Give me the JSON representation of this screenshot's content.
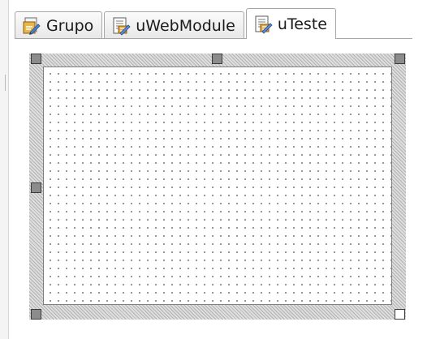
{
  "tabs": [
    {
      "label": "Grupo",
      "icon": "project-group-icon",
      "active": false
    },
    {
      "label": "uWebModule",
      "icon": "unit-form-icon",
      "active": false
    },
    {
      "label": "uTeste",
      "icon": "unit-form-icon",
      "active": true
    }
  ],
  "colors": {
    "handle_fill": "#8c8c8c",
    "grid_dot": "#6e6e6e",
    "hatch": "#b2b2b2"
  }
}
